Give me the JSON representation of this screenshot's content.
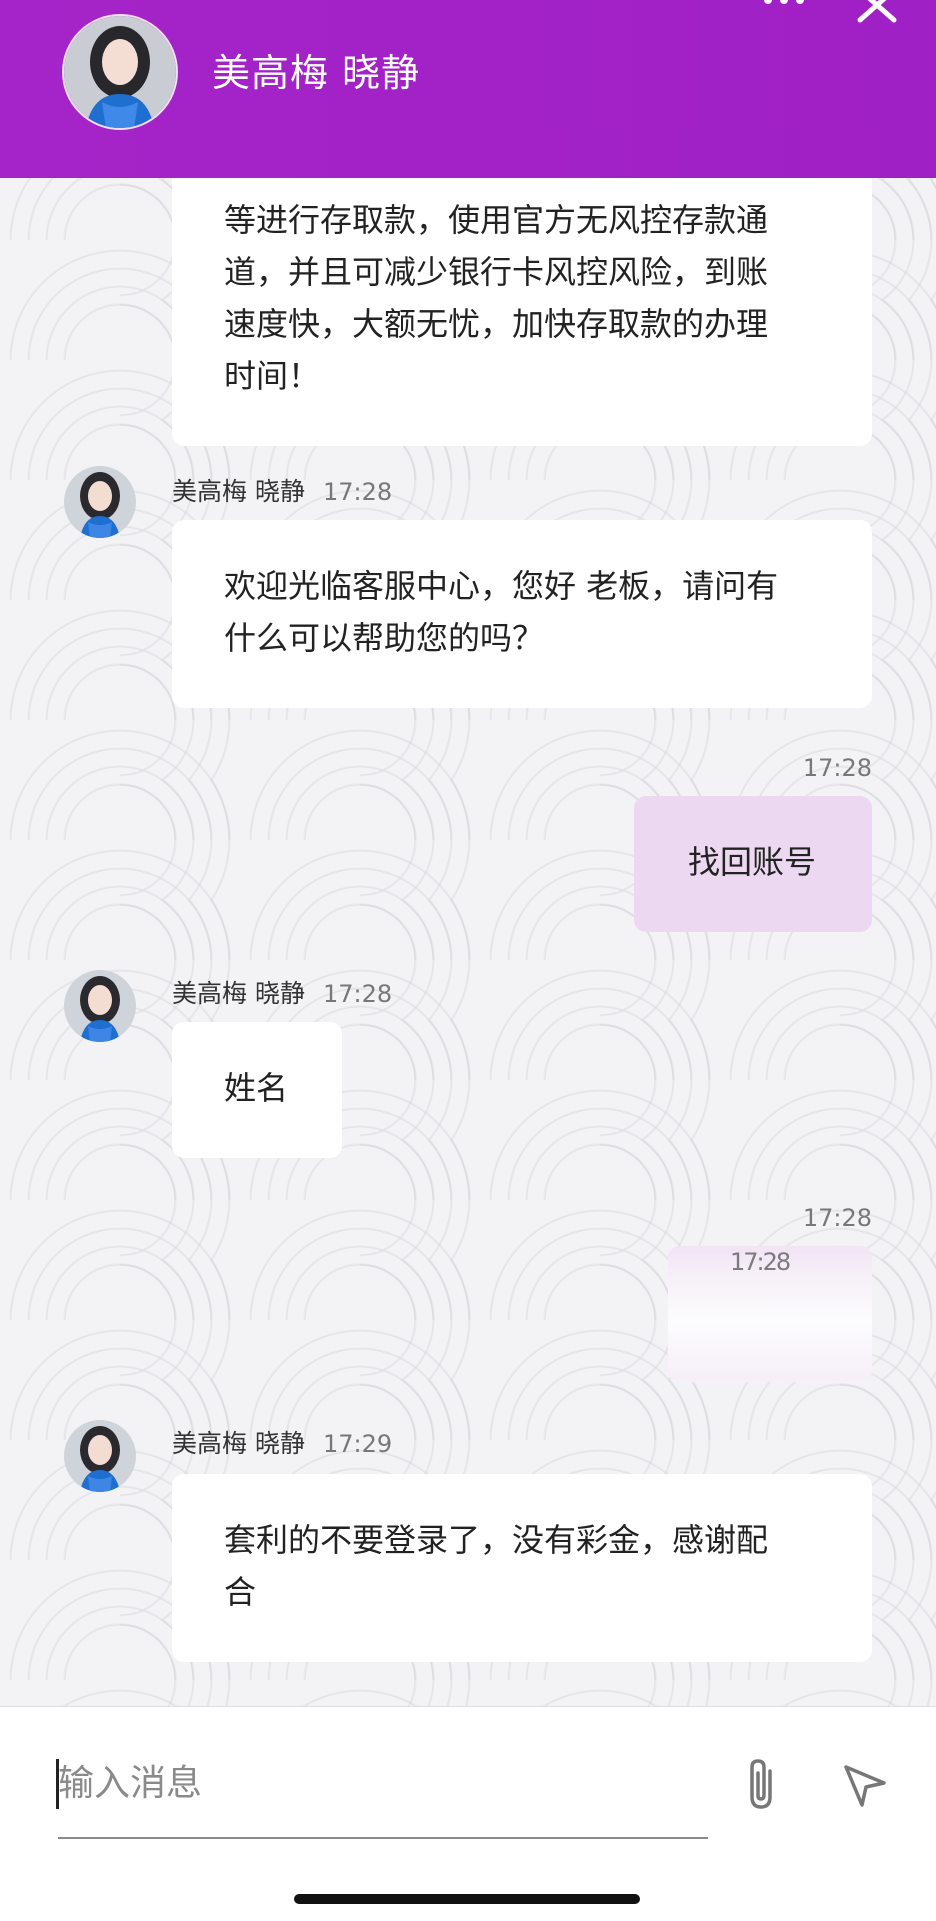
{
  "header": {
    "title": "美高梅 晓静",
    "more_icon": "more-dots-icon",
    "close_icon": "close-icon"
  },
  "messages": [
    {
      "sender": "",
      "time": "",
      "lines": [
        "等进行存取款，使用官方无风控存款通",
        "道，并且可减少银行卡风控风险，到账",
        "速度快，大额无忧，加快存取款的办理",
        "时间！"
      ]
    },
    {
      "sender": "美高梅 晓静",
      "time": "17:28",
      "lines": [
        "欢迎光临客服中心，您好 老板，请问有",
        "什么可以帮助您的吗？"
      ]
    },
    {
      "sender": "self",
      "time": "17:28",
      "lines": [
        "找回账号"
      ]
    },
    {
      "sender": "美高梅 晓静",
      "time": "17:28",
      "lines": [
        "姓名"
      ]
    },
    {
      "sender": "self",
      "time": "17:28",
      "lines": [
        "17:28"
      ]
    },
    {
      "sender": "美高梅 晓静",
      "time": "17:29",
      "lines": [
        "套利的不要登录了，没有彩金，感谢配",
        "合"
      ]
    }
  ],
  "input": {
    "placeholder": "输入消息",
    "attach_icon": "paperclip-icon",
    "send_icon": "send-icon"
  },
  "colors": {
    "header": "#a524c9",
    "self_bubble": "#ecd8f1",
    "other_bubble": "#ffffff"
  }
}
